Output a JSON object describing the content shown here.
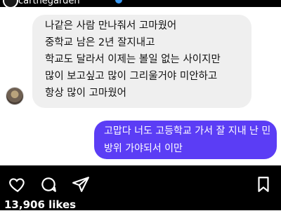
{
  "post": {
    "username": "carthegarden",
    "likes_text": "13,906 likes"
  },
  "chat": {
    "received_lines": [
      "나같은 사람 만나줘서 고마웠어",
      "중학교 남은 2년 잘지내고",
      "학교도 달라서 이제는 볼일 없는 사이지만",
      "많이 보고싶고 많이 그리울거야 미안하고",
      "항상 많이  고마웠어"
    ],
    "sent_lines": [
      "고맙다 너도 고등학교 가서 잘 지내 난 민",
      "방위 가야되서 이만"
    ]
  },
  "icons": {
    "heart": "heart-icon",
    "comment": "comment-icon",
    "share": "share-icon",
    "bookmark": "bookmark-icon",
    "verified": "verified-badge-icon"
  },
  "colors": {
    "sent_bubble": "#5b3df5",
    "received_bubble": "#efefef",
    "bar": "#000000"
  }
}
